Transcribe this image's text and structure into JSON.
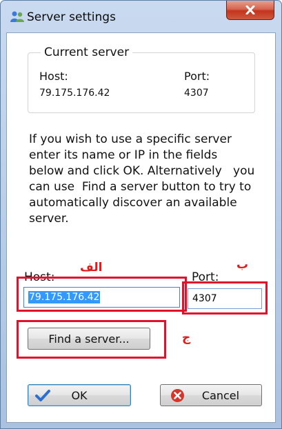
{
  "window": {
    "title": "Server settings",
    "close_glyph": "X"
  },
  "current_server": {
    "legend": "Current server",
    "host_label": "Host:",
    "host_value": "79.175.176.42",
    "port_label": "Port:",
    "port_value": "4307"
  },
  "info_text": "If you wish to use a specific server\nenter its name or IP in the fields\nbelow and click OK. Alternatively   you\ncan use  Find a server button to try to\nautomatically discover an available\nserver.",
  "form": {
    "host_label": "Host:",
    "host_value": "79.175.176.42",
    "port_label": "Port:",
    "port_value": "4307"
  },
  "annotations": {
    "host": "الف",
    "port": "ب",
    "find": "ج",
    "highlight_color": "#e0122b"
  },
  "buttons": {
    "find_server": "Find a server...",
    "ok": "OK",
    "cancel": "Cancel"
  },
  "icons": {
    "app": "users-icon",
    "ok": "checkmark-icon",
    "cancel": "cancel-x-icon"
  }
}
